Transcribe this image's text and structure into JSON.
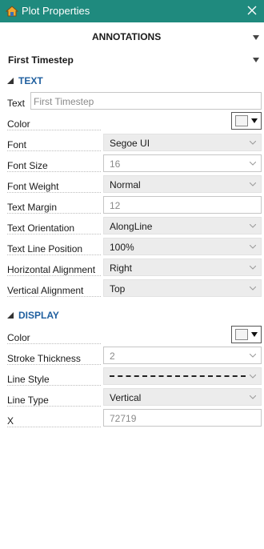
{
  "window": {
    "title": "Plot Properties"
  },
  "sections": {
    "annotations": "ANNOTATIONS",
    "selected_item": "First Timestep"
  },
  "text_group": {
    "header": "TEXT",
    "text": {
      "label": "Text",
      "value": "First Timestep"
    },
    "color": {
      "label": "Color",
      "value": "#f4f4f4"
    },
    "font": {
      "label": "Font",
      "value": "Segoe UI"
    },
    "font_size": {
      "label": "Font Size",
      "value": "16"
    },
    "font_weight": {
      "label": "Font Weight",
      "value": "Normal"
    },
    "text_margin": {
      "label": "Text Margin",
      "value": "12"
    },
    "text_orientation": {
      "label": "Text Orientation",
      "value": "AlongLine"
    },
    "text_line_position": {
      "label": "Text Line Position",
      "value": "100%"
    },
    "horizontal_alignment": {
      "label": "Horizontal Alignment",
      "value": "Right"
    },
    "vertical_alignment": {
      "label": "Vertical Alignment",
      "value": "Top"
    }
  },
  "display_group": {
    "header": "DISPLAY",
    "color": {
      "label": "Color",
      "value": "#f4f4f4"
    },
    "stroke_thickness": {
      "label": "Stroke Thickness",
      "value": "2"
    },
    "line_style": {
      "label": "Line Style",
      "value": "dashed"
    },
    "line_type": {
      "label": "Line Type",
      "value": "Vertical"
    },
    "x": {
      "label": "X",
      "value": "72719"
    }
  },
  "colors": {
    "titlebar": "#1f8a7e",
    "group_header": "#1f5f9f"
  },
  "icons": [
    "home-icon",
    "close-icon",
    "chevron-down-icon",
    "collapse-triangle-icon",
    "dropdown-arrow-icon"
  ]
}
